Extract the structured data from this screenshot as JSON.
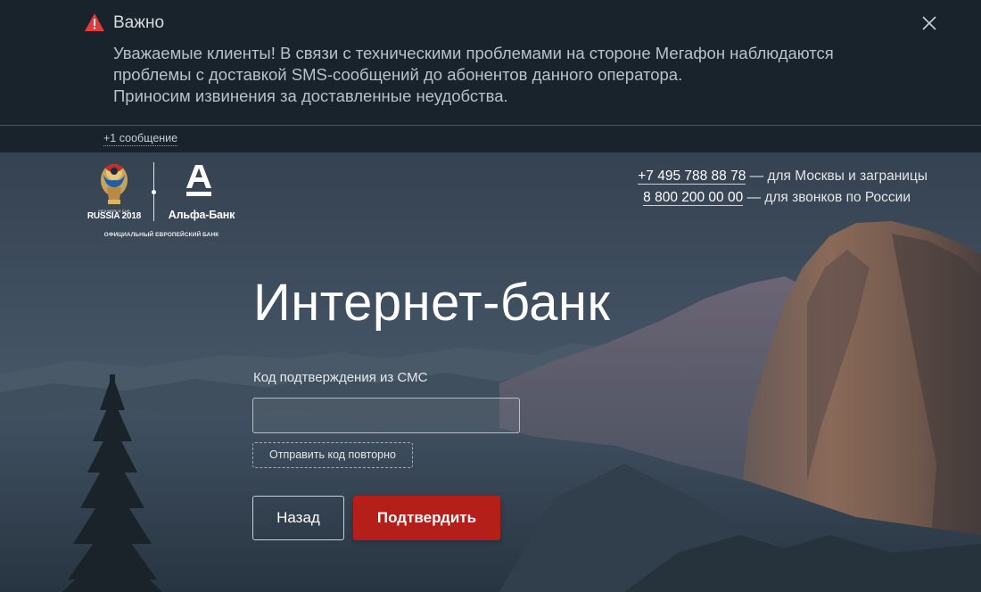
{
  "notice": {
    "icon": "warning-icon",
    "title": "Важно",
    "lines": [
      "Уважаемые клиенты! В связи с техническими проблемами на стороне Мегафон наблюдаются",
      "проблемы с доставкой SMS-сообщений до абонентов данного оператора.",
      "Приносим извинения за доставленные неудобства."
    ],
    "close_icon": "close-icon",
    "more_messages": "+1 сообщение"
  },
  "header": {
    "worldcup_logo": {
      "small_text": "FIFA WORLD CUP",
      "title": "RUSSIA 2018"
    },
    "bank_name": "Альфа-Банк",
    "tagline": "ОФИЦИАЛЬНЫЙ ЕВРОПЕЙСКИЙ БАНК",
    "phones": [
      {
        "number": "+7 495 788 88 78",
        "description": " — для Москвы и заграницы"
      },
      {
        "number": "8 800 200 00 00",
        "description": " — для звонков по России"
      }
    ]
  },
  "login": {
    "title": "Интернет-банк",
    "sms_label": "Код подтверждения из СМС",
    "sms_value": "",
    "sms_placeholder": "",
    "resend_label": "Отправить код повторно",
    "back_label": "Назад",
    "confirm_label": "Подтвердить"
  },
  "colors": {
    "accent": "#b41f1a",
    "warning": "#e03a3a",
    "notice_bg": "#18212a"
  }
}
